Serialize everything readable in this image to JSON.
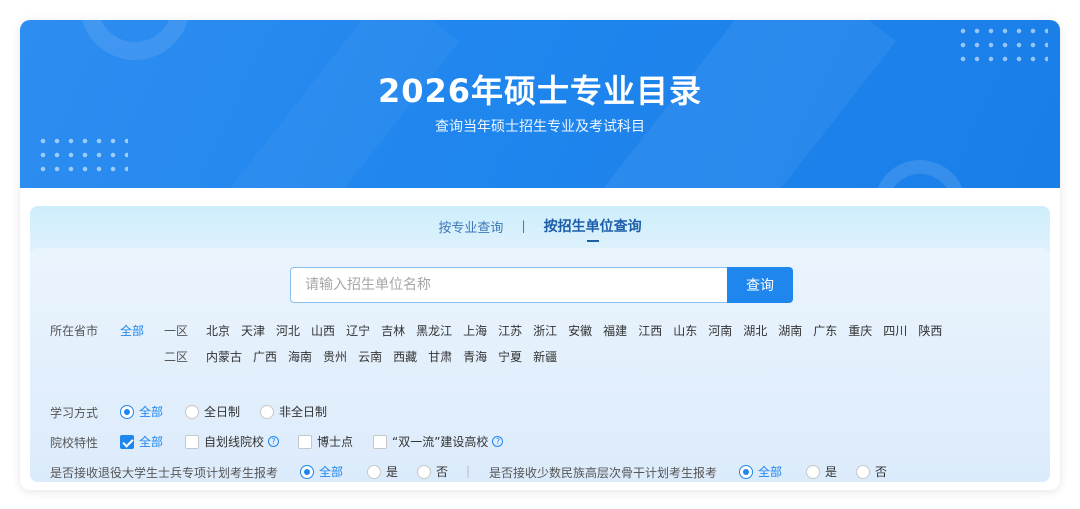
{
  "banner": {
    "title": "2026年硕士专业目录",
    "subtitle": "查询当年硕士招生专业及考试科目"
  },
  "tabs": [
    {
      "label": "按专业查询",
      "active": false
    },
    {
      "label": "按招生单位查询",
      "active": true
    }
  ],
  "tab_separator": "|",
  "search": {
    "placeholder": "请输入招生单位名称",
    "value": "",
    "button_label": "查询"
  },
  "province": {
    "label": "所在省市",
    "all_label": "全部",
    "zone1_label": "一区",
    "zone1": [
      "北京",
      "天津",
      "河北",
      "山西",
      "辽宁",
      "吉林",
      "黑龙江",
      "上海",
      "江苏",
      "浙江",
      "安徽",
      "福建",
      "江西",
      "山东",
      "河南",
      "湖北",
      "湖南",
      "广东",
      "重庆",
      "四川",
      "陕西"
    ],
    "zone2_label": "二区",
    "zone2": [
      "内蒙古",
      "广西",
      "海南",
      "贵州",
      "云南",
      "西藏",
      "甘肃",
      "青海",
      "宁夏",
      "新疆"
    ]
  },
  "study_mode": {
    "label": "学习方式",
    "options": [
      "全部",
      "全日制",
      "非全日制"
    ],
    "selected": "全部"
  },
  "school_features": {
    "label": "院校特性",
    "options": [
      "全部",
      "自划线院校",
      "博士点",
      "“双一流”建设高校"
    ],
    "checked": [
      "全部"
    ]
  },
  "veteran_plan": {
    "label": "是否接收退役大学生士兵专项计划考生报考",
    "options": [
      "全部",
      "是",
      "否"
    ],
    "selected": "全部"
  },
  "minority_plan": {
    "label": "是否接收少数民族高层次骨干计划考生报考",
    "options": [
      "全部",
      "是",
      "否"
    ],
    "selected": "全部"
  },
  "filter_separator": "|",
  "colors": {
    "accent": "#1f86ee",
    "banner": "#2e8df0",
    "active_tab": "#1d5ea9"
  },
  "icons": {
    "help": "question-circle-icon",
    "checked": "checkmark-icon"
  }
}
